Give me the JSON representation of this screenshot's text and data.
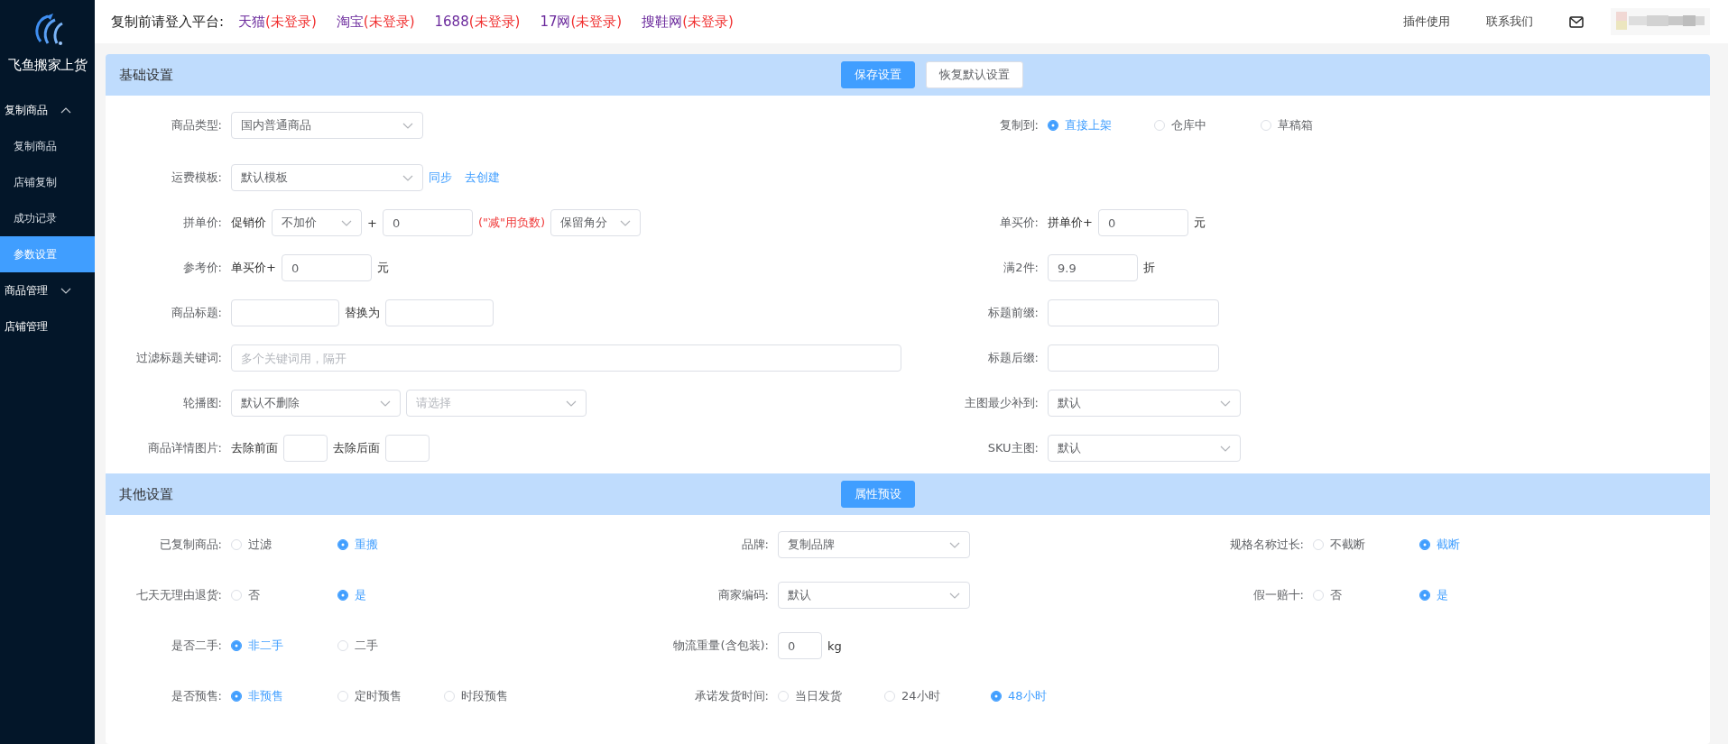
{
  "sidebar": {
    "app_name": "飞鱼搬家上货",
    "menu": [
      {
        "label": "复制商品",
        "selected": false,
        "expanded": true,
        "children": [
          {
            "label": "复制商品",
            "selected": false
          },
          {
            "label": "店铺复制",
            "selected": false
          },
          {
            "label": "成功记录",
            "selected": false
          },
          {
            "label": "参数设置",
            "selected": true
          }
        ]
      },
      {
        "label": "商品管理",
        "selected": false,
        "expanded": false
      },
      {
        "label": "店铺管理",
        "selected": false
      }
    ]
  },
  "topbar": {
    "prompt": "复制前请登入平台:",
    "platforms": [
      {
        "name": "天猫",
        "status": "(未登录)"
      },
      {
        "name": "淘宝",
        "status": "(未登录)"
      },
      {
        "name": "1688",
        "status": "(未登录)"
      },
      {
        "name": "17网",
        "status": "(未登录)"
      },
      {
        "name": "搜鞋网",
        "status": "(未登录)"
      }
    ],
    "links": [
      "插件使用",
      "联系我们"
    ]
  },
  "sections": [
    {
      "title": "基础设置",
      "buttons": [
        {
          "label": "保存设置",
          "primary": true
        },
        {
          "label": "恢复默认设置",
          "primary": false
        }
      ],
      "rows": [
        {
          "cells": [
            {
              "label": "商品类型:",
              "controls": [
                {
                  "kind": "select",
                  "value": "国内普通商品"
                }
              ]
            },
            {
              "label": "复制到:",
              "controls": [
                {
                  "kind": "radio",
                  "options": [
                    {
                      "label": "直接上架",
                      "selected": true
                    },
                    {
                      "label": "仓库中",
                      "selected": false
                    },
                    {
                      "label": "草稿箱",
                      "selected": false
                    }
                  ]
                }
              ]
            }
          ]
        },
        {
          "cells": [
            {
              "label": "运费模板:",
              "controls": [
                {
                  "kind": "select",
                  "value": "默认模板"
                },
                {
                  "kind": "link",
                  "text": "同步"
                },
                {
                  "kind": "link",
                  "text": "去创建"
                }
              ]
            }
          ]
        },
        {
          "cells": [
            {
              "label": "拼单价:",
              "controls": [
                {
                  "kind": "text",
                  "text": "促销价"
                },
                {
                  "kind": "select",
                  "value": "不加价"
                },
                {
                  "kind": "text",
                  "text": "+"
                },
                {
                  "kind": "input",
                  "value": "0"
                },
                {
                  "kind": "hint",
                  "text": "(\"减\"用负数)"
                },
                {
                  "kind": "select",
                  "value": "保留角分"
                }
              ]
            },
            {
              "label": "单买价:",
              "controls": [
                {
                  "kind": "text",
                  "text": "拼单价+"
                },
                {
                  "kind": "input",
                  "value": "0"
                },
                {
                  "kind": "text",
                  "text": "元"
                }
              ]
            }
          ]
        },
        {
          "cells": [
            {
              "label": "参考价:",
              "controls": [
                {
                  "kind": "text",
                  "text": "单买价+"
                },
                {
                  "kind": "input",
                  "value": "0"
                },
                {
                  "kind": "text",
                  "text": "元"
                }
              ]
            },
            {
              "label": "满2件:",
              "controls": [
                {
                  "kind": "input",
                  "value": "9.9"
                },
                {
                  "kind": "text",
                  "text": "折"
                }
              ]
            }
          ]
        },
        {
          "cells": [
            {
              "label": "商品标题:",
              "controls": [
                {
                  "kind": "input"
                },
                {
                  "kind": "text",
                  "text": "替换为"
                },
                {
                  "kind": "input"
                }
              ]
            },
            {
              "label": "标题前缀:",
              "controls": [
                {
                  "kind": "input"
                }
              ]
            }
          ]
        },
        {
          "cells": [
            {
              "label": "过滤标题关键词:",
              "controls": [
                {
                  "kind": "input",
                  "placeholder": "多个关键词用，隔开"
                }
              ]
            },
            {
              "label": "标题后缀:",
              "controls": [
                {
                  "kind": "input"
                }
              ]
            }
          ]
        },
        {
          "cells": [
            {
              "label": "轮播图:",
              "controls": [
                {
                  "kind": "select",
                  "value": "默认不删除"
                },
                {
                  "kind": "select",
                  "placeholder": "请选择"
                }
              ]
            },
            {
              "label": "主图最少补到:",
              "controls": [
                {
                  "kind": "select",
                  "value": "默认"
                }
              ]
            }
          ]
        },
        {
          "cells": [
            {
              "label": "商品详情图片:",
              "controls": [
                {
                  "kind": "text",
                  "text": "去除前面"
                },
                {
                  "kind": "input"
                },
                {
                  "kind": "text",
                  "text": "去除后面"
                },
                {
                  "kind": "input"
                }
              ]
            },
            {
              "label": "SKU主图:",
              "controls": [
                {
                  "kind": "select",
                  "value": "默认"
                }
              ]
            }
          ]
        }
      ]
    },
    {
      "title": "其他设置",
      "buttons": [
        {
          "label": "属性预设",
          "primary": true
        }
      ],
      "rows": [
        {
          "cells": [
            {
              "label": "已复制商品:",
              "controls": [
                {
                  "kind": "radio",
                  "options": [
                    {
                      "label": "过滤",
                      "selected": false
                    },
                    {
                      "label": "重搬",
                      "selected": true
                    }
                  ]
                }
              ]
            },
            {
              "label": "品牌:",
              "controls": [
                {
                  "kind": "select",
                  "value": "复制品牌"
                }
              ]
            },
            {
              "label": "规格名称过长:",
              "controls": [
                {
                  "kind": "radio",
                  "options": [
                    {
                      "label": "不截断",
                      "selected": false
                    },
                    {
                      "label": "截断",
                      "selected": true
                    }
                  ]
                }
              ]
            }
          ]
        },
        {
          "cells": [
            {
              "label": "七天无理由退货:",
              "controls": [
                {
                  "kind": "radio",
                  "options": [
                    {
                      "label": "否",
                      "selected": false
                    },
                    {
                      "label": "是",
                      "selected": true
                    }
                  ]
                }
              ]
            },
            {
              "label": "商家编码:",
              "controls": [
                {
                  "kind": "select",
                  "value": "默认"
                }
              ]
            },
            {
              "label": "假一赔十:",
              "controls": [
                {
                  "kind": "radio",
                  "options": [
                    {
                      "label": "否",
                      "selected": false
                    },
                    {
                      "label": "是",
                      "selected": true
                    }
                  ]
                }
              ]
            }
          ]
        },
        {
          "cells": [
            {
              "label": "是否二手:",
              "controls": [
                {
                  "kind": "radio",
                  "options": [
                    {
                      "label": "非二手",
                      "selected": true
                    },
                    {
                      "label": "二手",
                      "selected": false
                    }
                  ]
                }
              ]
            },
            {
              "label": "物流重量(含包装):",
              "controls": [
                {
                  "kind": "input",
                  "value": "0"
                },
                {
                  "kind": "text",
                  "text": "kg"
                }
              ]
            }
          ]
        },
        {
          "cells": [
            {
              "label": "是否预售:",
              "controls": [
                {
                  "kind": "radio",
                  "options": [
                    {
                      "label": "非预售",
                      "selected": true
                    },
                    {
                      "label": "定时预售",
                      "selected": false
                    },
                    {
                      "label": "时段预售",
                      "selected": false
                    }
                  ]
                }
              ]
            },
            {
              "label": "承诺发货时间:",
              "controls": [
                {
                  "kind": "radio",
                  "options": [
                    {
                      "label": "当日发货",
                      "selected": false
                    },
                    {
                      "label": "24小时",
                      "selected": false
                    },
                    {
                      "label": "48小时",
                      "selected": true
                    }
                  ]
                }
              ]
            }
          ]
        }
      ]
    }
  ]
}
